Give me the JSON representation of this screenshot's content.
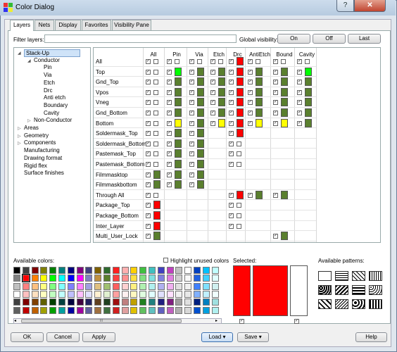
{
  "window": {
    "title": "Color Dialog",
    "help_glyph": "?",
    "close_glyph": "✕"
  },
  "tabs": [
    "Layers",
    "Nets",
    "Display",
    "Favorites",
    "Visibility Pane"
  ],
  "filter": {
    "label": "Filter layers:",
    "value": ""
  },
  "global_visibility": {
    "label": "Global visibility:",
    "on": "On",
    "off": "Off",
    "last": "Last"
  },
  "tree": [
    {
      "label": "Stack-Up",
      "level": 0,
      "expanded": true,
      "selected": true
    },
    {
      "label": "Conductor",
      "level": 1,
      "expanded": true
    },
    {
      "label": "Pin",
      "level": 2
    },
    {
      "label": "Via",
      "level": 2
    },
    {
      "label": "Etch",
      "level": 2
    },
    {
      "label": "Drc",
      "level": 2
    },
    {
      "label": "Anti etch",
      "level": 2
    },
    {
      "label": "Boundary",
      "level": 2
    },
    {
      "label": "Cavity",
      "level": 2
    },
    {
      "label": "Non-Conductor",
      "level": 1,
      "expanded": false
    },
    {
      "label": "Areas",
      "level": 0,
      "expanded": false
    },
    {
      "label": "Geometry",
      "level": 0,
      "expanded": false
    },
    {
      "label": "Components",
      "level": 0,
      "expanded": false
    },
    {
      "label": "Manufacturing",
      "level": 0
    },
    {
      "label": "Drawing format",
      "level": 0
    },
    {
      "label": "Rigid flex",
      "level": 0
    },
    {
      "label": "Surface finishes",
      "level": 0
    }
  ],
  "grid": {
    "columns": [
      "All",
      "Pin",
      "Via",
      "Etch",
      "Drc",
      "AntiEtch",
      "Bound",
      "Cavity"
    ],
    "check_glyph": "✓",
    "rows": [
      {
        "name": "All",
        "cells": [
          "",
          "",
          "",
          "",
          "#ff0000",
          "",
          "",
          ""
        ]
      },
      {
        "name": "Top",
        "cells": [
          "",
          "#00ff00",
          "#5a7f2e",
          "#5a7f2e",
          "#ff0000",
          "#5a7f2e",
          "#5a7f2e",
          "#00ff00"
        ]
      },
      {
        "name": "Gnd_Top",
        "cells": [
          "",
          "#5a7f2e",
          "#5a7f2e",
          "#5a7f2e",
          "#ff0000",
          "#5a7f2e",
          "#5a7f2e",
          "#5a7f2e"
        ]
      },
      {
        "name": "Vpos",
        "cells": [
          "",
          "#5a7f2e",
          "#5a7f2e",
          "#5a7f2e",
          "#ff0000",
          "#5a7f2e",
          "#5a7f2e",
          "#5a7f2e"
        ]
      },
      {
        "name": "Vneg",
        "cells": [
          "",
          "#5a7f2e",
          "#5a7f2e",
          "#5a7f2e",
          "#ff0000",
          "#5a7f2e",
          "#5a7f2e",
          "#5a7f2e"
        ]
      },
      {
        "name": "Gnd_Bottom",
        "cells": [
          "",
          "#5a7f2e",
          "#5a7f2e",
          "#5a7f2e",
          "#ff0000",
          "#5a7f2e",
          "#5a7f2e",
          "#5a7f2e"
        ]
      },
      {
        "name": "Bottom",
        "cells": [
          "",
          "#ffff00",
          "#5a7f2e",
          "#ffff00",
          "#ff0000",
          "#ffff00",
          "#ffff00",
          "#5a7f2e"
        ]
      },
      {
        "name": "Soldermask_Top",
        "cells": [
          "",
          "#5a7f2e",
          "#5a7f2e",
          null,
          "#ff0000",
          null,
          null,
          null
        ]
      },
      {
        "name": "Soldermask_Bottom",
        "cells": [
          "",
          "#5a7f2e",
          "#5a7f2e",
          null,
          "",
          null,
          null,
          null
        ]
      },
      {
        "name": "Pastemask_Top",
        "cells": [
          "",
          "#5a7f2e",
          "#5a7f2e",
          null,
          "",
          null,
          null,
          null
        ]
      },
      {
        "name": "Pastemask_Bottom",
        "cells": [
          "",
          "#5a7f2e",
          "#5a7f2e",
          null,
          "",
          null,
          null,
          null
        ]
      },
      {
        "name": "Filmmasktop",
        "cells": [
          "#5a7f2e",
          "#5a7f2e",
          "#5a7f2e",
          null,
          null,
          null,
          null,
          null
        ]
      },
      {
        "name": "Filmmaskbottom",
        "cells": [
          "#5a7f2e",
          "#5a7f2e",
          "#5a7f2e",
          null,
          null,
          null,
          null,
          null
        ]
      },
      {
        "name": "Through All",
        "cells": [
          "",
          null,
          null,
          null,
          "#ff0000",
          "#5a7f2e",
          "#5a7f2e",
          null
        ]
      },
      {
        "name": "Package_Top",
        "cells": [
          "#ff0000",
          null,
          null,
          null,
          "",
          null,
          null,
          null
        ]
      },
      {
        "name": "Package_Bottom",
        "cells": [
          "#ff0000",
          null,
          null,
          null,
          "",
          null,
          null,
          null
        ]
      },
      {
        "name": "Inter_Layer",
        "cells": [
          "#ff0000",
          null,
          null,
          null,
          "",
          null,
          null,
          null
        ]
      },
      {
        "name": "Multi_User_Lock",
        "cells": [
          "#5a7f2e",
          null,
          null,
          null,
          null,
          null,
          "#5a7f2e",
          null
        ]
      }
    ]
  },
  "available_colors": {
    "label": "Available colors:",
    "highlight_unused": "Highlight unused colors",
    "scroll_glyph": "III"
  },
  "selected": {
    "label": "Selected:",
    "color": "#ff0000"
  },
  "patterns": {
    "label": "Available patterns:"
  },
  "buttons": {
    "ok": "OK",
    "cancel": "Cancel",
    "apply": "Apply",
    "load": "Load",
    "save": "Save",
    "help": "Help"
  }
}
